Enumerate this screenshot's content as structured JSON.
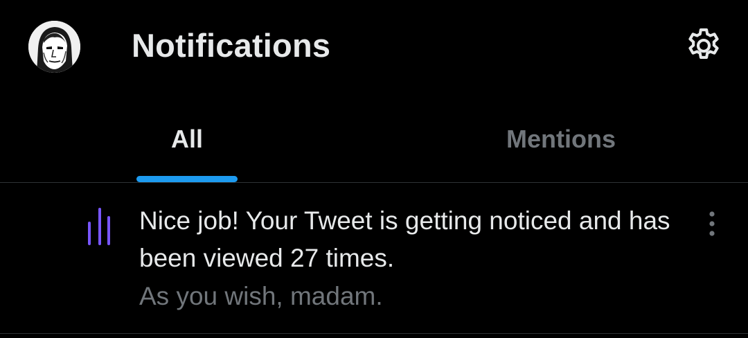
{
  "header": {
    "title": "Notifications",
    "avatar_icon": "user-avatar",
    "settings_icon": "gear-icon"
  },
  "tabs": [
    {
      "label": "All",
      "active": true
    },
    {
      "label": "Mentions",
      "active": false
    }
  ],
  "notifications": [
    {
      "icon": "views-bars-icon",
      "text": "Nice job! Your Tweet is getting noticed and has been viewed 27 times.",
      "subtext": "As you wish, madam.",
      "menu_icon": "more-vertical-icon"
    }
  ],
  "colors": {
    "background": "#000000",
    "primary_text": "#e7e9ea",
    "secondary_text": "#71767b",
    "accent": "#1d9bf0",
    "views_icon": "#7856ff",
    "divider": "#2f3336"
  }
}
